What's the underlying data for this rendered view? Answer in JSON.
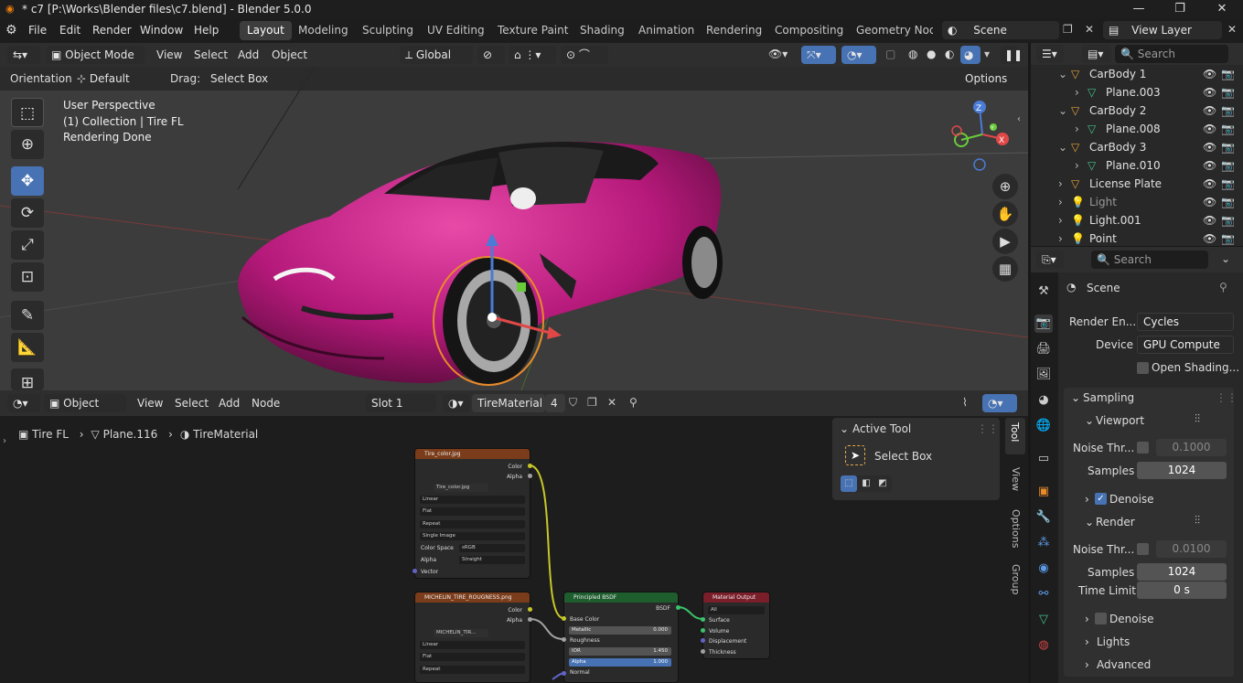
{
  "window": {
    "title": "* c7 [P:\\Works\\Blender files\\c7.blend] - Blender 5.0.0",
    "minimize": "—",
    "maximize": "❐",
    "close": "✕"
  },
  "menu": [
    "File",
    "Edit",
    "Render",
    "Window",
    "Help"
  ],
  "workspaces": [
    "Layout",
    "Modeling",
    "Sculpting",
    "UV Editing",
    "Texture Paint",
    "Shading",
    "Animation",
    "Rendering",
    "Compositing",
    "Geometry Node"
  ],
  "scene": {
    "name": "Scene",
    "view_layer": "View Layer"
  },
  "viewport": {
    "mode": "Object Mode",
    "menus": [
      "View",
      "Select",
      "Add",
      "Object"
    ],
    "transform": "Global",
    "orientation_label": "Orientation:",
    "orientation": "Default",
    "drag_label": "Drag:",
    "drag": "Select Box",
    "options": "Options",
    "overlay_lines": [
      "User Perspective",
      "(1) Collection | Tire FL",
      "Rendering Done"
    ],
    "gizmo": {
      "x": "X",
      "y": "Y",
      "z": "Z"
    },
    "car_color": "#b5197a"
  },
  "node_editor": {
    "editor": "Object",
    "menus": [
      "View",
      "Select",
      "Add",
      "Node"
    ],
    "slot": "Slot 1",
    "material": "TireMaterial",
    "users": "4",
    "breadcrumb": [
      "Tire FL",
      "Plane.116",
      "TireMaterial"
    ],
    "active_tool": {
      "title": "Active Tool",
      "tool": "Select Box"
    },
    "side_tabs": [
      "Tool",
      "View",
      "Options",
      "Group"
    ],
    "nodes": {
      "tex1": {
        "title": "Tire_color.jpg",
        "outs": [
          "Color",
          "Alpha"
        ],
        "file": "Tire_color.jpg",
        "rows": [
          "Linear",
          "Flat",
          "Repeat",
          "Single Image"
        ],
        "cs_label": "Color Space",
        "cs": "sRGB",
        "alpha_label": "Alpha",
        "alpha": "Straight",
        "vector": "Vector"
      },
      "tex2": {
        "title": "MICHELIN_TIRE_ROUGNESS.png",
        "outs": [
          "Color",
          "Alpha"
        ],
        "file": "MICHELIN_TIR...",
        "rows": [
          "Linear",
          "Flat",
          "Repeat"
        ]
      },
      "bsdf": {
        "title": "Principled BSDF",
        "out": "BSDF",
        "base": "Base Color",
        "metallic": "Metallic",
        "metallic_val": "0.000",
        "rough": "Roughness",
        "ior": "IOR",
        "ior_val": "1.450",
        "alpha": "Alpha",
        "alpha_val": "1.000",
        "normal": "Normal"
      },
      "out": {
        "title": "Material Output",
        "target": "All",
        "ins": [
          "Surface",
          "Volume",
          "Displacement",
          "Thickness"
        ]
      }
    }
  },
  "outliner": {
    "search": "Search",
    "items": [
      {
        "name": "CarBody 1",
        "icon": "▽",
        "color": "#e3a03b",
        "indent": 0,
        "expanded": true
      },
      {
        "name": "Plane.003",
        "icon": "▽",
        "color": "#41c38a",
        "indent": 1
      },
      {
        "name": "CarBody 2",
        "icon": "▽",
        "color": "#e3a03b",
        "indent": 0,
        "expanded": true
      },
      {
        "name": "Plane.008",
        "icon": "▽",
        "color": "#41c38a",
        "indent": 1
      },
      {
        "name": "CarBody 3",
        "icon": "▽",
        "color": "#e3a03b",
        "indent": 0,
        "expanded": true
      },
      {
        "name": "Plane.010",
        "icon": "▽",
        "color": "#41c38a",
        "indent": 1
      },
      {
        "name": "License Plate",
        "icon": "▽",
        "color": "#e3a03b",
        "indent": 0
      },
      {
        "name": "Light",
        "icon": "💡",
        "color": "#e3a03b",
        "indent": 0,
        "dim": true
      },
      {
        "name": "Light.001",
        "icon": "💡",
        "color": "#e3a03b",
        "indent": 0
      },
      {
        "name": "Point",
        "icon": "💡",
        "color": "#e3a03b",
        "indent": 0
      }
    ]
  },
  "properties": {
    "search": "Search",
    "context": "Scene",
    "render_engine_label": "Render En...",
    "render_engine": "Cycles",
    "device_label": "Device",
    "device": "GPU Compute",
    "open_shading": "Open Shading...",
    "sampling": "Sampling",
    "viewport": "Viewport",
    "noise_label": "Noise Thr...",
    "vp_noise": "0.1000",
    "samples_label": "Samples",
    "vp_samples": "1024",
    "denoise": "Denoise",
    "render": "Render",
    "r_noise": "0.0100",
    "r_samples": "1024",
    "time_limit_label": "Time Limit",
    "time_limit": "0 s",
    "lights": "Lights",
    "advanced": "Advanced"
  }
}
